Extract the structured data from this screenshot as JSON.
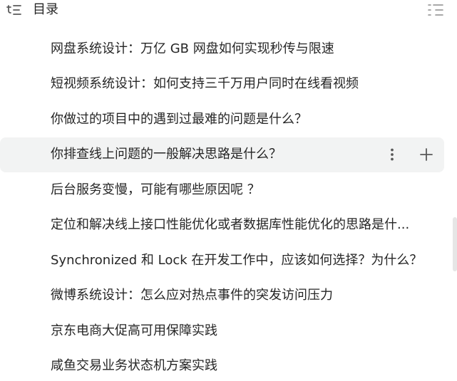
{
  "header": {
    "title": "目录",
    "toc_icon": "toc-list-icon",
    "collapse_icon": "collapse-list-icon"
  },
  "items": [
    {
      "label": "网盘系统设计：万亿 GB 网盘如何实现秒传与限速"
    },
    {
      "label": "短视频系统设计：如何支持三千万用户同时在线看视频"
    },
    {
      "label": "你做过的项目中的遇到过最难的问题是什么？"
    },
    {
      "label": "你排查线上问题的一般解决思路是什么？",
      "active": true
    },
    {
      "label": "后台服务变慢，可能有哪些原因呢 ？"
    },
    {
      "label": "定位和解决线上接口性能优化或者数据库性能优化的思路是什..."
    },
    {
      "label": "Synchronized 和 Lock 在开发工作中，应该如何选择？为什么？"
    },
    {
      "label": "微博系统设计：怎么应对热点事件的突发访问压力"
    },
    {
      "label": "京东电商大促高可用保障实践"
    },
    {
      "label": "咸鱼交易业务状态机方案实践"
    }
  ],
  "item_actions": {
    "more_icon": "more-vertical-icon",
    "add_icon": "plus-icon"
  },
  "colors": {
    "text": "#262626",
    "active_bg": "#f2f3f3",
    "icon": "#595959"
  }
}
